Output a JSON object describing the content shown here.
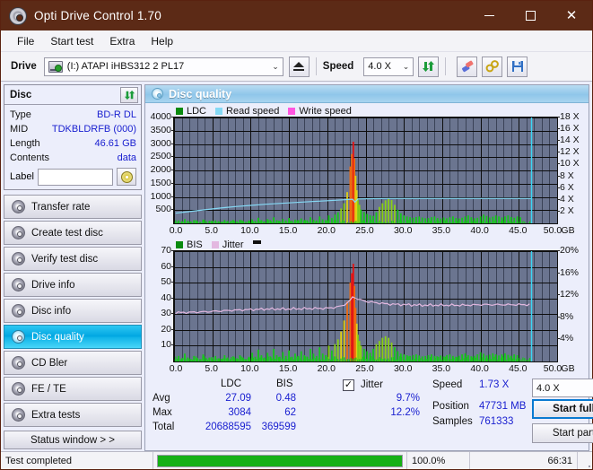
{
  "window": {
    "title": "Opti Drive Control 1.70",
    "icon": "disc-icon",
    "minimize": "–",
    "maximize": "□",
    "close": "✕"
  },
  "menu": [
    "File",
    "Start test",
    "Extra",
    "Help"
  ],
  "toolbar": {
    "drive_label": "Drive",
    "drive_value": "(I:)   ATAPI iHBS312   2 PL17",
    "eject_icon": "eject-icon",
    "speed_label": "Speed",
    "speed_value": "4.0 X",
    "refresh_icon": "refresh-icon",
    "erase_icon": "eraser-icon",
    "tools_icon": "tools-icon",
    "save_icon": "save-icon",
    "chevron": "⌄"
  },
  "disc": {
    "header": "Disc",
    "refresh_icon": "refresh-icon",
    "rows": [
      {
        "key": "Type",
        "value": "BD-R DL"
      },
      {
        "key": "MID",
        "value": "TDKBLDRFB (000)"
      },
      {
        "key": "Length",
        "value": "46.61 GB"
      },
      {
        "key": "Contents",
        "value": "data"
      }
    ],
    "label_key": "Label",
    "label_value": "",
    "label_icon": "cd-icon"
  },
  "nav": {
    "items": [
      {
        "label": "Transfer rate",
        "selected": false
      },
      {
        "label": "Create test disc",
        "selected": false
      },
      {
        "label": "Verify test disc",
        "selected": false
      },
      {
        "label": "Drive info",
        "selected": false
      },
      {
        "label": "Disc info",
        "selected": false
      },
      {
        "label": "Disc quality",
        "selected": true
      },
      {
        "label": "CD Bler",
        "selected": false
      },
      {
        "label": "FE / TE",
        "selected": false
      },
      {
        "label": "Extra tests",
        "selected": false
      }
    ],
    "status_window": "Status window > >"
  },
  "panel": {
    "title": "Disc quality",
    "icon": "disc-quality-icon"
  },
  "colors": {
    "plot_bg": "#6b7590",
    "grid": "#101010",
    "ldc_green": "#16c81a",
    "bis_green": "#16c81a",
    "read_speed": "#85d9f5",
    "write_speed": "#ff55e0",
    "jitter": "#e3b8e0",
    "marker_cyan": "#3ad6f5",
    "value_blue": "#1a20d0",
    "accent_blue": "#0a7ad1",
    "titlebar": "#5c2a16"
  },
  "chart_data": [
    {
      "type": "area",
      "name": "ldc-chart",
      "title": "",
      "legend": [
        {
          "label": "LDC",
          "color": "#0a8a0f"
        },
        {
          "label": "Read speed",
          "color": "#85d9f5"
        },
        {
          "label": "Write speed",
          "color": "#ff55e0"
        }
      ],
      "legend_position": "top-left",
      "xlabel": "GB",
      "xlim": [
        0,
        50
      ],
      "xticks": [
        "0.0",
        "5.0",
        "10.0",
        "15.0",
        "20.0",
        "25.0",
        "30.0",
        "35.0",
        "40.0",
        "45.0",
        "50.0"
      ],
      "ylabel_left": "LDC",
      "ylim": [
        0,
        4000
      ],
      "yticks": [
        500,
        1000,
        1500,
        2000,
        2500,
        3000,
        3500,
        4000
      ],
      "ylabel_right": "X",
      "ylim_right": [
        0,
        18
      ],
      "yticks_right": [
        "2 X",
        "4 X",
        "6 X",
        "8 X",
        "10 X",
        "12 X",
        "14 X",
        "16 X",
        "18 X"
      ],
      "grid": true,
      "data_end_gb": 46.6,
      "series": [
        {
          "name": "LDC",
          "color": "#16c81a",
          "type": "spike-area",
          "x": [
            0.2,
            0.6,
            1.0,
            1.4,
            1.8,
            2.2,
            2.6,
            3.0,
            3.4,
            3.8,
            4.2,
            4.6,
            5.0,
            5.4,
            5.8,
            6.2,
            6.6,
            7.0,
            7.4,
            7.8,
            8.2,
            8.6,
            9.0,
            9.4,
            9.8,
            10.2,
            10.6,
            11.0,
            11.4,
            11.8,
            12.2,
            12.6,
            13.0,
            13.4,
            13.8,
            14.2,
            14.6,
            15.0,
            15.4,
            15.8,
            16.2,
            16.6,
            17.0,
            17.4,
            17.8,
            18.2,
            18.6,
            19.0,
            19.4,
            19.8,
            20.2,
            20.6,
            21.0,
            21.4,
            21.8,
            22.2,
            22.6,
            23.0,
            23.2,
            23.4,
            23.55,
            23.7,
            23.85,
            24.0,
            24.2,
            24.4,
            24.8,
            25.2,
            25.6,
            26.0,
            26.4,
            26.8,
            27.2,
            27.6,
            28.0,
            28.4,
            28.8,
            29.2,
            29.6,
            30.0,
            30.4,
            30.8,
            31.2,
            31.6,
            32.0,
            32.4,
            32.8,
            33.2,
            33.6,
            34.0,
            34.4,
            34.8,
            35.2,
            35.6,
            36.0,
            36.4,
            36.8,
            37.2,
            37.6,
            38.0,
            38.4,
            38.8,
            39.2,
            39.6,
            40.0,
            40.4,
            40.8,
            41.2,
            41.6,
            42.0,
            42.4,
            42.8,
            43.2,
            43.6,
            44.0,
            44.4,
            44.8,
            45.2,
            45.6,
            46.0,
            46.4
          ],
          "y": [
            60,
            110,
            80,
            160,
            95,
            70,
            120,
            85,
            60,
            140,
            75,
            95,
            70,
            110,
            80,
            60,
            125,
            90,
            70,
            105,
            80,
            130,
            95,
            60,
            110,
            150,
            95,
            210,
            120,
            80,
            160,
            100,
            230,
            120,
            90,
            170,
            110,
            200,
            95,
            140,
            110,
            185,
            120,
            95,
            230,
            140,
            110,
            260,
            150,
            120,
            300,
            200,
            330,
            420,
            560,
            760,
            1180,
            2150,
            2620,
            3084,
            2450,
            1800,
            1250,
            900,
            700,
            520,
            430,
            360,
            300,
            280,
            420,
            620,
            760,
            870,
            930,
            880,
            700,
            520,
            380,
            300,
            260,
            230,
            210,
            240,
            260,
            220,
            190,
            200,
            230,
            260,
            200,
            180,
            220,
            190,
            230,
            260,
            200,
            180,
            210,
            260,
            300,
            230,
            190,
            210,
            260,
            330,
            280,
            220,
            250,
            300,
            260,
            220,
            260,
            300,
            240,
            210,
            260,
            230
          ]
        },
        {
          "name": "Read speed",
          "color": "#85d9f5",
          "type": "line",
          "x": [
            0.2,
            2,
            4,
            6,
            8,
            10,
            12,
            14,
            16,
            18,
            20,
            22,
            23.3,
            23.6,
            24,
            26,
            28,
            30,
            32,
            34,
            36,
            38,
            40,
            42,
            44,
            46,
            46.6
          ],
          "y": [
            1.72,
            2.0,
            2.3,
            2.6,
            2.85,
            3.05,
            3.25,
            3.4,
            3.55,
            3.7,
            3.85,
            4.0,
            4.1,
            3.6,
            4.15,
            4.2,
            4.22,
            4.22,
            4.22,
            4.22,
            4.22,
            4.22,
            4.22,
            4.22,
            4.22,
            4.22,
            4.22
          ]
        }
      ]
    },
    {
      "type": "area",
      "name": "bis-chart",
      "title": "",
      "legend": [
        {
          "label": "BIS",
          "color": "#0a8a0f"
        },
        {
          "label": "Jitter",
          "color": "#e3b8e0"
        }
      ],
      "legend_position": "top-left",
      "xlabel": "GB",
      "xlim": [
        0,
        50
      ],
      "xticks": [
        "0.0",
        "5.0",
        "10.0",
        "15.0",
        "20.0",
        "25.0",
        "30.0",
        "35.0",
        "40.0",
        "45.0",
        "50.0"
      ],
      "ylabel_left": "BIS",
      "ylim": [
        0,
        70
      ],
      "yticks": [
        10,
        20,
        30,
        40,
        50,
        60,
        70
      ],
      "ylabel_right": "%",
      "ylim_right": [
        0,
        20
      ],
      "yticks_right": [
        "4%",
        "8%",
        "12%",
        "16%",
        "20%"
      ],
      "grid": true,
      "data_end_gb": 46.6,
      "series": [
        {
          "name": "BIS",
          "color": "#16c81a",
          "type": "spike-area",
          "x": [
            0.2,
            0.6,
            1.0,
            1.4,
            1.8,
            2.2,
            2.6,
            3.0,
            3.4,
            3.8,
            4.2,
            4.6,
            5.0,
            5.4,
            5.8,
            6.2,
            6.6,
            7.0,
            7.4,
            7.8,
            8.2,
            8.6,
            9.0,
            9.4,
            9.8,
            10.2,
            10.6,
            11.0,
            11.4,
            11.8,
            12.2,
            12.6,
            13.0,
            13.4,
            13.8,
            14.2,
            14.6,
            15.0,
            15.4,
            15.8,
            16.2,
            16.6,
            17.0,
            17.4,
            17.8,
            18.2,
            18.6,
            19.0,
            19.4,
            19.8,
            20.2,
            20.6,
            21.0,
            21.4,
            21.8,
            22.2,
            22.6,
            23.0,
            23.2,
            23.4,
            23.55,
            23.7,
            23.85,
            24.0,
            24.2,
            24.4,
            24.8,
            25.2,
            25.6,
            26.0,
            26.4,
            26.8,
            27.2,
            27.6,
            28.0,
            28.4,
            28.8,
            29.2,
            29.6,
            30.0,
            30.4,
            30.8,
            31.2,
            31.6,
            32.0,
            32.4,
            32.8,
            33.2,
            33.6,
            34.0,
            34.4,
            34.8,
            35.2,
            35.6,
            36.0,
            36.4,
            36.8,
            37.2,
            37.6,
            38.0,
            38.4,
            38.8,
            39.2,
            39.6,
            40.0,
            40.4,
            40.8,
            41.2,
            41.6,
            42.0,
            42.4,
            42.8,
            43.2,
            43.6,
            44.0,
            44.4,
            44.8,
            45.2,
            45.6,
            46.0,
            46.4
          ],
          "y": [
            1.5,
            3.5,
            2.0,
            5.0,
            2.5,
            1.5,
            3.5,
            2.0,
            1.5,
            4.5,
            2.0,
            2.5,
            1.5,
            3.5,
            2.0,
            1.5,
            4.0,
            2.5,
            1.5,
            3.0,
            2.0,
            4.0,
            2.5,
            1.5,
            3.0,
            5.5,
            3.0,
            7.5,
            4.0,
            2.5,
            5.5,
            3.0,
            8.0,
            4.0,
            3.0,
            6.0,
            3.5,
            7.0,
            3.0,
            5.0,
            3.5,
            6.5,
            4.0,
            3.0,
            8.0,
            5.0,
            3.5,
            9.0,
            5.0,
            4.0,
            10.0,
            7.0,
            11.0,
            14.0,
            19.0,
            26.0,
            38.0,
            50.0,
            56.0,
            62.0,
            48.0,
            34.0,
            24.0,
            17.0,
            13.0,
            10.0,
            8.0,
            6.5,
            5.5,
            8.0,
            11.0,
            13.0,
            15.0,
            16.0,
            15.0,
            12.0,
            9.0,
            6.5,
            5.0,
            4.5,
            4.0,
            3.5,
            4.0,
            4.5,
            3.8,
            3.2,
            3.5,
            4.0,
            4.5,
            3.5,
            3.0,
            3.8,
            3.2,
            4.0,
            4.5,
            3.5,
            3.0,
            3.6,
            4.5,
            5.2,
            4.0,
            3.3,
            3.6,
            4.5,
            5.8,
            4.9,
            3.8,
            4.3,
            5.2,
            4.5,
            3.8,
            4.5,
            5.2,
            4.2,
            3.6,
            4.5,
            4.0
          ]
        },
        {
          "name": "Jitter",
          "color": "#e3b8e0",
          "type": "line",
          "x": [
            0.2,
            2,
            4,
            6,
            8,
            10,
            12,
            14,
            16,
            18,
            20,
            21,
            22,
            23,
            23.4,
            23.6,
            24,
            25,
            26,
            28,
            30,
            32,
            34,
            36,
            38,
            40,
            42,
            44,
            46,
            46.6
          ],
          "y": [
            8.85,
            8.9,
            9.0,
            9.15,
            9.3,
            9.4,
            9.5,
            9.5,
            9.55,
            9.6,
            9.65,
            9.8,
            10.1,
            11.0,
            11.9,
            11.6,
            11.3,
            10.9,
            10.7,
            10.4,
            10.3,
            10.2,
            10.2,
            10.2,
            10.2,
            10.3,
            10.3,
            10.3,
            10.3,
            10.3
          ]
        }
      ]
    }
  ],
  "stats": {
    "columns": [
      "LDC",
      "BIS"
    ],
    "rows": [
      {
        "label": "Avg",
        "ldc": "27.09",
        "bis": "0.48",
        "jitter": "9.7%"
      },
      {
        "label": "Max",
        "ldc": "3084",
        "bis": "62",
        "jitter": "12.2%"
      },
      {
        "label": "Total",
        "ldc": "20688595",
        "bis": "369599",
        "jitter": ""
      }
    ],
    "jitter_label": "Jitter",
    "jitter_checked": true,
    "checkmark": "✓",
    "speed_label": "Speed",
    "speed_value": "1.73 X",
    "position_label": "Position",
    "position_value": "47731 MB",
    "samples_label": "Samples",
    "samples_value": "761333",
    "speed_select": "4.0 X",
    "start_full": "Start full",
    "start_part": "Start part",
    "chevron": "⌄"
  },
  "statusbar": {
    "message": "Test completed",
    "progress_percent": 100,
    "progress_text": "100.0%",
    "elapsed": "66:31"
  }
}
